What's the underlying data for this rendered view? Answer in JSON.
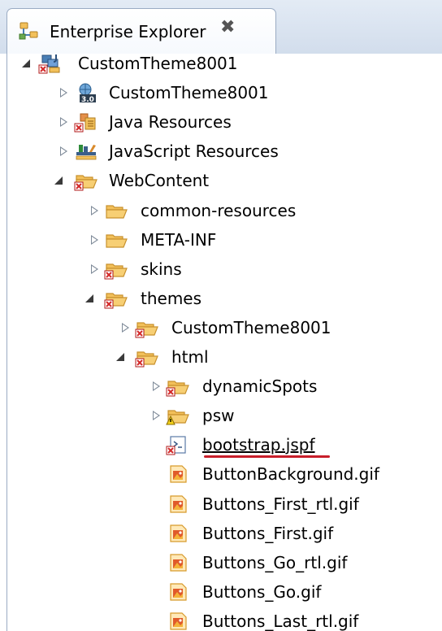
{
  "view": {
    "title": "Enterprise Explorer",
    "close_glyph": "✖"
  },
  "tree": [
    {
      "label": "CustomTheme8001",
      "state": "expanded",
      "icon": "project-error-icon"
    },
    {
      "label": "CustomTheme8001",
      "state": "collapsed",
      "icon": "web-module-3.0-icon"
    },
    {
      "label": "Java Resources",
      "state": "collapsed",
      "icon": "java-resources-error-icon"
    },
    {
      "label": "JavaScript Resources",
      "state": "collapsed",
      "icon": "javascript-library-icon"
    },
    {
      "label": "WebContent",
      "state": "expanded",
      "icon": "folder-open-error-icon"
    },
    {
      "label": "common-resources",
      "state": "collapsed",
      "icon": "folder-icon"
    },
    {
      "label": "META-INF",
      "state": "collapsed",
      "icon": "folder-icon"
    },
    {
      "label": "skins",
      "state": "collapsed",
      "icon": "folder-error-icon"
    },
    {
      "label": "themes",
      "state": "expanded",
      "icon": "folder-open-error-icon"
    },
    {
      "label": "CustomTheme8001",
      "state": "collapsed",
      "icon": "folder-error-icon"
    },
    {
      "label": "html",
      "state": "expanded",
      "icon": "folder-open-error-icon"
    },
    {
      "label": "dynamicSpots",
      "state": "collapsed",
      "icon": "folder-error-icon"
    },
    {
      "label": "psw",
      "state": "collapsed",
      "icon": "folder-warning-icon"
    },
    {
      "label": "bootstrap.jspf",
      "state": "leaf",
      "icon": "jspf-file-error-icon",
      "highlighted": true
    },
    {
      "label": "ButtonBackground.gif",
      "state": "leaf",
      "icon": "gif-image-icon"
    },
    {
      "label": "Buttons_First_rtl.gif",
      "state": "leaf",
      "icon": "gif-image-icon"
    },
    {
      "label": "Buttons_First.gif",
      "state": "leaf",
      "icon": "gif-image-icon"
    },
    {
      "label": "Buttons_Go_rtl.gif",
      "state": "leaf",
      "icon": "gif-image-icon"
    },
    {
      "label": "Buttons_Go.gif",
      "state": "leaf",
      "icon": "gif-image-icon"
    },
    {
      "label": "Buttons_Last_rtl.gif",
      "state": "leaf",
      "icon": "gif-image-icon"
    }
  ],
  "colors": {
    "folder": "#f2c05a",
    "folder_dark": "#c8912e",
    "error": "#d42a2a",
    "warning": "#f5d31a",
    "highlight_line": "#c81e2a"
  }
}
